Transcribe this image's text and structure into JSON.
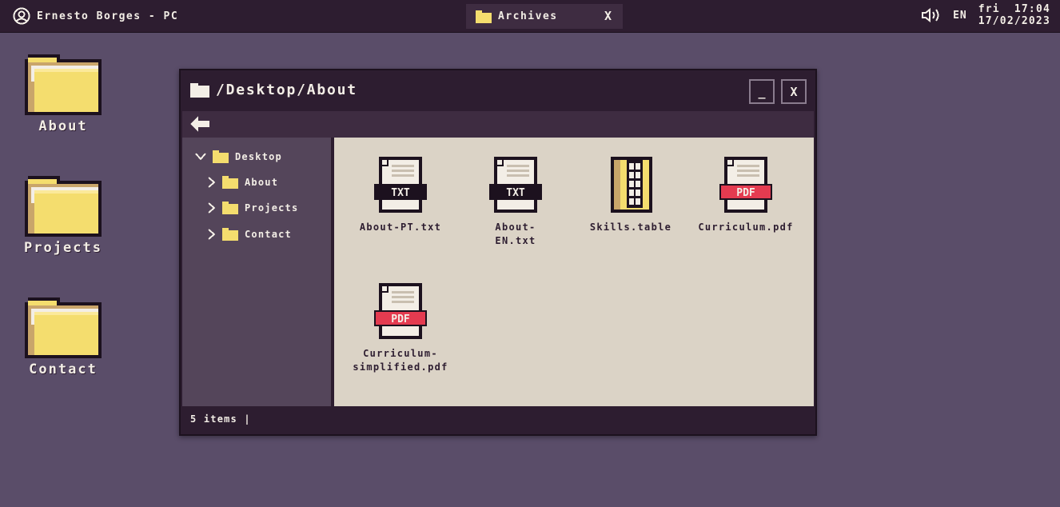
{
  "taskbar": {
    "user_name": "Ernesto Borges - PC",
    "task_label": "Archives",
    "task_close": "X",
    "language": "EN",
    "day": "fri",
    "time": "17:04",
    "date": "17/02/2023"
  },
  "desktop": {
    "icons": [
      {
        "label": "About"
      },
      {
        "label": "Projects"
      },
      {
        "label": "Contact"
      }
    ]
  },
  "window": {
    "path": "/Desktop/About",
    "minimize_label": "_",
    "close_label": "X",
    "tree": {
      "root": "Desktop",
      "children": [
        {
          "label": "About"
        },
        {
          "label": "Projects"
        },
        {
          "label": "Contact"
        }
      ]
    },
    "files": [
      {
        "name": "About-PT.txt",
        "type": "TXT"
      },
      {
        "name": "About-\nEN.txt",
        "type": "TXT"
      },
      {
        "name": "Skills.table",
        "type": "table"
      },
      {
        "name": "Curriculum.pdf",
        "type": "PDF"
      },
      {
        "name": "Curriculum-\nsimplified.pdf",
        "type": "PDF"
      }
    ],
    "status": "5 items |"
  },
  "colors": {
    "desktop_bg": "#5a4d69",
    "bar_bg": "#2d1d30",
    "folder_yellow": "#f4dd6e",
    "pdf_red": "#e43b50",
    "content_bg": "#dbd3c6"
  }
}
